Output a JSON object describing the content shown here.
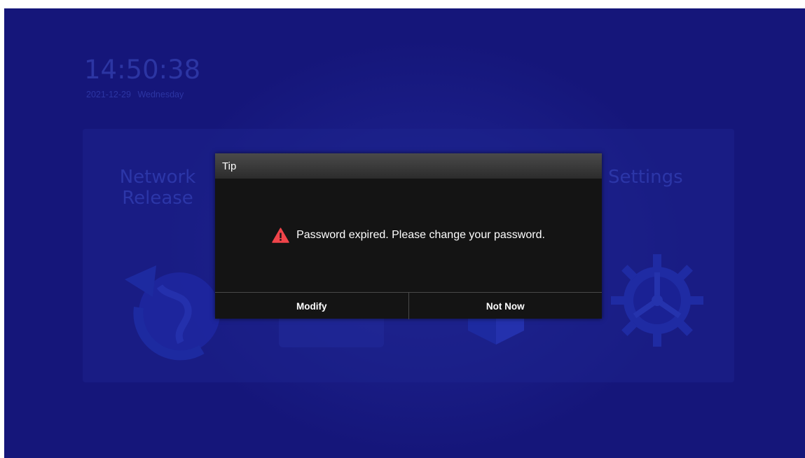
{
  "home": {
    "time": "14:50:38",
    "date": "2021-12-29",
    "weekday": "Wednesday",
    "apps": [
      {
        "label_line1": "Network",
        "label_line2": "Release",
        "icon": "globe-refresh-icon"
      },
      {
        "label_line1": "",
        "label_line2": "",
        "icon": "monitor-icon"
      },
      {
        "label_line1": "",
        "label_line2": "",
        "icon": "usb-cube-icon"
      },
      {
        "label_line1": "Settings",
        "label_line2": "",
        "icon": "gear-icon"
      }
    ]
  },
  "dialog": {
    "title": "Tip",
    "icon": "warning-triangle-icon",
    "message": "Password expired. Please change your password.",
    "buttons": {
      "modify": "Modify",
      "not_now": "Not Now"
    }
  },
  "colors": {
    "background": "#15167a",
    "dialog_body": "#141414",
    "warning": "#f0444a",
    "dim_text": "#2c35a3"
  }
}
